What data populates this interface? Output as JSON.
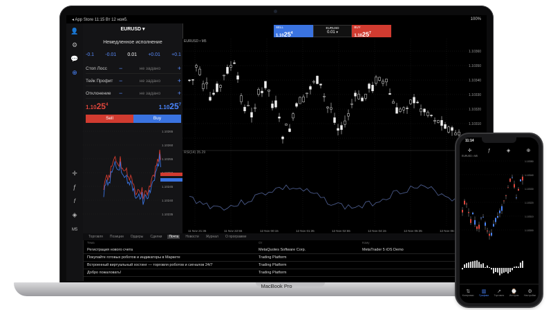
{
  "status_bar": {
    "left": "◂ App Store   11:15   Вт 12 нояб.",
    "right": "100%"
  },
  "symbol": "EURUSD",
  "execution_title": "Немедленное исполнение",
  "volume": {
    "minus_big": "-0.1",
    "minus_small": "-0.01",
    "value": "0.01",
    "plus_small": "+0.01",
    "plus_big": "+0.1"
  },
  "params": [
    {
      "label": "Стоп Лосс",
      "value": "не задано"
    },
    {
      "label": "Тейк Профит",
      "value": "не задано"
    },
    {
      "label": "Отклонение",
      "value": "не задано"
    }
  ],
  "prices": {
    "bid_prefix": "1.10",
    "bid_main": "25",
    "bid_sup": "4",
    "ask_prefix": "1.10",
    "ask_main": "25",
    "ask_sup": "7"
  },
  "trade": {
    "sell": "Sell",
    "buy": "Buy"
  },
  "toolbar": {
    "sell_label": "SELL",
    "symbol": "EURUSD",
    "volume": "0.01",
    "buy_label": "BUY"
  },
  "chart_header": "EURUSD • M5",
  "main_price_axis": [
    "1.10360",
    "1.10350",
    "1.10340",
    "1.10330",
    "1.10320",
    "1.10310",
    "1.10300"
  ],
  "indicator_label": "RSI(14) 35.29",
  "indicator_axis": [
    "1.10265",
    "1.10260",
    "1.10255",
    "1.10250",
    "1.10245",
    "1.10240",
    "1.10235"
  ],
  "time_axis": [
    "11 Nov 21:35",
    "11 Nov 22:55",
    "12 Nov 00:15",
    "12 Nov 01:35",
    "12 Nov 02:55",
    "12 Nov 04:15",
    "12 Nov 05:35",
    "12 Nov 06:55"
  ],
  "mini_axis": [
    "1.10265",
    "1.10260",
    "1.10255",
    "1.10250",
    "1.10245",
    "1.10240",
    "1.10235"
  ],
  "tabs": [
    "Торговля",
    "Позиции",
    "Ордеры",
    "Сделки",
    "Почта",
    "Новости",
    "Журнал",
    "О программе"
  ],
  "active_tab": 4,
  "news_headers": {
    "subject": "Тема",
    "from": "От",
    "to": "Кому"
  },
  "news": [
    {
      "subject": "Регистрация нового счета",
      "from": "MetaQuotes Software Corp.",
      "to": "MetaTrader 5 iOS Demo"
    },
    {
      "subject": "Покупайте готовых роботов и индикаторы в Маркете",
      "from": "Trading Platform",
      "to": ""
    },
    {
      "subject": "Встроенный виртуальный хостинг — торговля роботов и сигналов 24/7",
      "from": "Trading Platform",
      "to": ""
    },
    {
      "subject": "Добро пожаловать!",
      "from": "Trading Platform",
      "to": ""
    }
  ],
  "laptop_label": "MacBook Pro",
  "phone": {
    "time": "11:14",
    "chart_header": "EURUSD • M5",
    "axis": [
      "1.10350",
      "1.10340",
      "1.10330",
      "1.10320",
      "1.10310",
      "1.10300"
    ],
    "nav": [
      "Котировки",
      "Графики",
      "Торговля",
      "История",
      "Настройки"
    ]
  }
}
